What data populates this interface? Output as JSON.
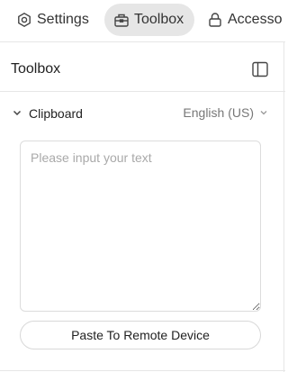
{
  "tabs": [
    {
      "label": "Settings",
      "icon": "gear-icon",
      "active": false
    },
    {
      "label": "Toolbox",
      "icon": "toolbox-icon",
      "active": true
    },
    {
      "label": "Accesso",
      "icon": "lock-icon",
      "active": false
    }
  ],
  "header": {
    "title": "Toolbox",
    "toggle_icon": "panel-toggle-icon"
  },
  "clipboard": {
    "title": "Clipboard",
    "language": "English (US)",
    "input_placeholder": "Please input your text",
    "input_value": "",
    "paste_label": "Paste To Remote Device"
  },
  "colors": {
    "active_tab_bg": "#e6e6e6",
    "border": "#e6e6e6",
    "placeholder": "#a9a9a9"
  }
}
